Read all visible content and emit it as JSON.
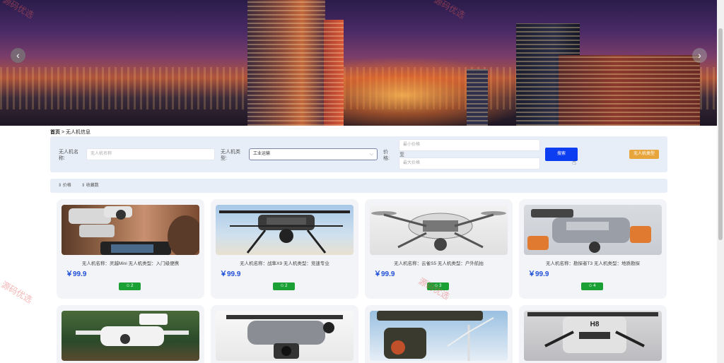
{
  "watermarks": [
    "源码优选",
    "源码优选",
    "源码优选",
    "源码优选"
  ],
  "breadcrumb": {
    "home": "首页",
    "separator": ">",
    "current": "无人机信息"
  },
  "search": {
    "name_label": "无人机名称:",
    "name_placeholder": "无人机名称",
    "type_label": "无人机类型:",
    "type_value": "工业运输",
    "price_label": "价格:",
    "price_min_placeholder": "最小价格",
    "price_to": "至",
    "price_max_placeholder": "最大价格",
    "search_button": "搜索",
    "type_button": "无人机类型"
  },
  "sort": {
    "price": "⇕ 价格",
    "favorites": "⇕ 收藏数"
  },
  "cards": [
    {
      "name": "无人机名称：灵越Mini",
      "type": "无人机类型：入门级便携",
      "price": "￥99.9",
      "favorites": "✩ 2"
    },
    {
      "name": "无人机名称：战隼X9",
      "type": "无人机类型：竞速专业",
      "price": "￥99.9",
      "favorites": "✩ 2"
    },
    {
      "name": "无人机名称：云雀S5",
      "type": "无人机类型：户外航拍",
      "price": "￥99.9",
      "favorites": "✩ 3"
    },
    {
      "name": "无人机名称：勘探者T3",
      "type": "无人机类型：地质勘探",
      "price": "￥99.9",
      "favorites": "✩ 4"
    }
  ],
  "second_row_labels": {
    "card2_logo": "H8"
  },
  "icons": [
    "chevron-left-icon",
    "chevron-right-icon",
    "chevron-down-icon",
    "star-icon",
    "sort-icon",
    "cursor-icon"
  ],
  "colors": {
    "search_button": "#0d3df0",
    "type_button": "#e7a53c",
    "favorite_badge": "#1aa035",
    "price": "#1f4fd8",
    "panel_bg": "#e8eef8"
  }
}
